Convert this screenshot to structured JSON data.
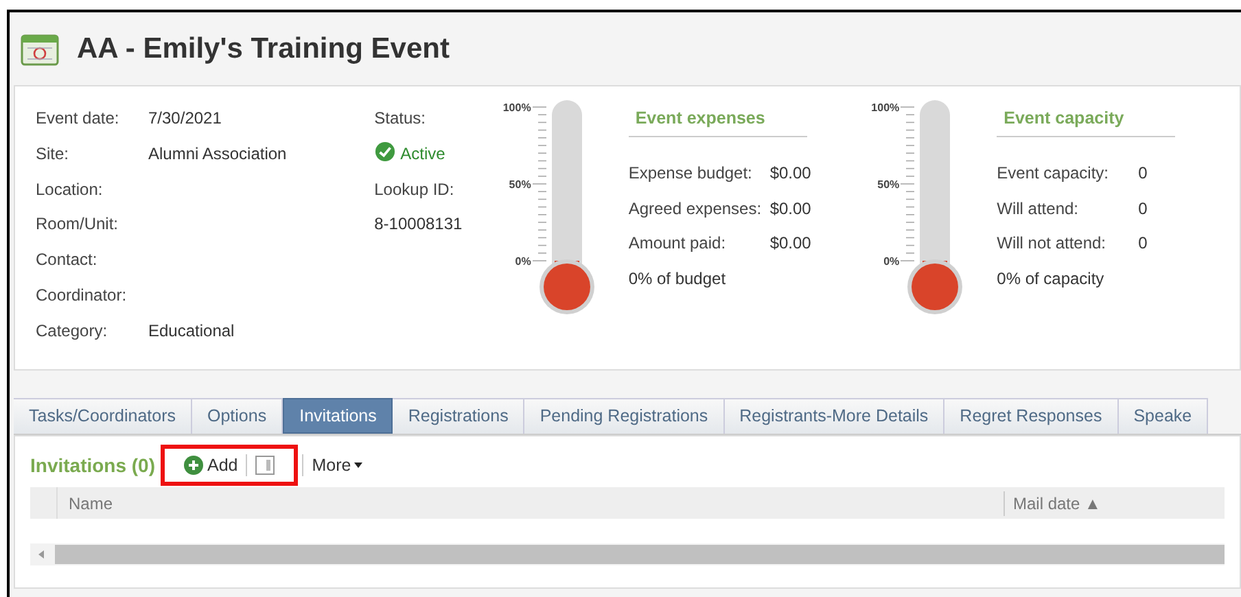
{
  "header": {
    "title": "AA - Emily's Training Event"
  },
  "details": [
    {
      "label": "Event date:",
      "value": "7/30/2021"
    },
    {
      "label": "Site:",
      "value": "Alumni Association"
    },
    {
      "label": "Location:"
    },
    {
      "label": "Room/Unit:"
    },
    {
      "label": "Contact:"
    },
    {
      "label": "Coordinator:"
    },
    {
      "label": "Category:",
      "value": "Educational"
    }
  ],
  "status": {
    "label": "Status:",
    "value": "Active",
    "lookup_label": "Lookup ID:",
    "lookup_value": "8-10008131"
  },
  "gauges": [
    {
      "ticks": [
        "100%",
        "50%",
        "0%"
      ],
      "title": "Event expenses",
      "rows": [
        {
          "label": "Expense budget:",
          "value": "$0.00"
        },
        {
          "label": "Agreed expenses:",
          "value": "$0.00"
        },
        {
          "label": "Amount paid:",
          "value": "$0.00"
        }
      ],
      "summary": "0% of budget"
    },
    {
      "ticks": [
        "100%",
        "50%",
        "0%"
      ],
      "title": "Event capacity",
      "rows": [
        {
          "label": "Event capacity:",
          "value": "0"
        },
        {
          "label": "Will attend:",
          "value": "0"
        },
        {
          "label": "Will not attend:",
          "value": "0"
        }
      ],
      "summary": "0% of capacity"
    }
  ],
  "tabs": [
    {
      "label": "Tasks/Coordinators",
      "selected": false
    },
    {
      "label": "Options",
      "selected": false
    },
    {
      "label": "Invitations",
      "selected": true
    },
    {
      "label": "Registrations",
      "selected": false
    },
    {
      "label": "Pending Registrations",
      "selected": false
    },
    {
      "label": "Registrants-More Details",
      "selected": false
    },
    {
      "label": "Regret Responses",
      "selected": false
    },
    {
      "label": "Speake",
      "selected": false
    }
  ],
  "section": {
    "title": "Invitations (0)",
    "add_label": "Add",
    "more_label": "More",
    "highlighted": true
  },
  "table": {
    "columns": [
      "Name",
      "Mail date ▲"
    ]
  }
}
